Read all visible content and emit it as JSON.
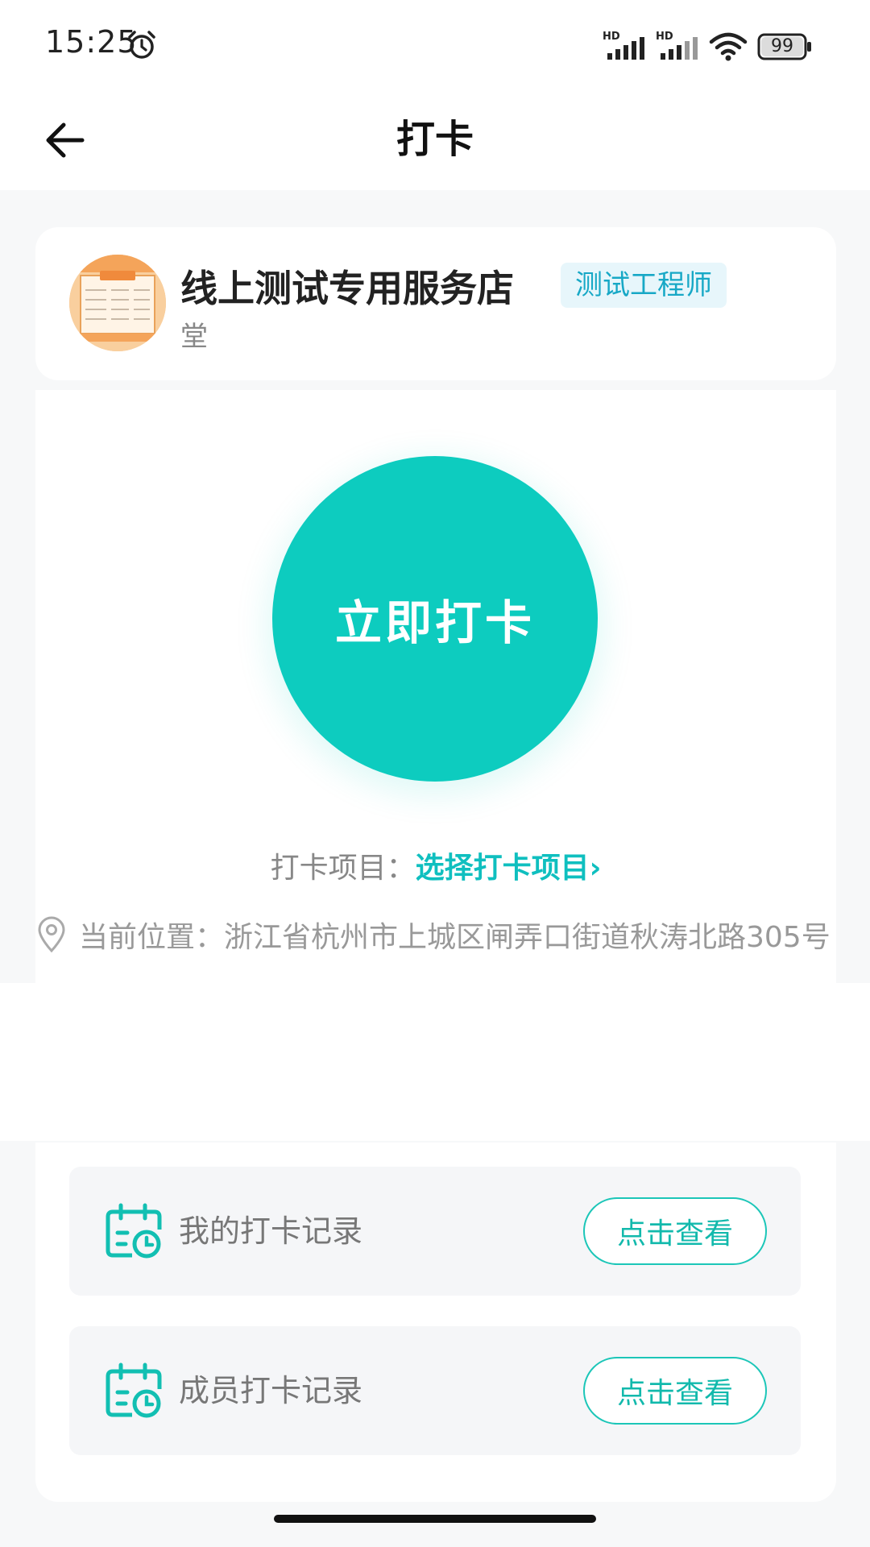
{
  "status_bar": {
    "time": "15:25",
    "signal_label_1": "HD",
    "signal_label_2": "HD",
    "battery": "99"
  },
  "nav": {
    "title": "打卡"
  },
  "store": {
    "name": "线上测试专用服务店",
    "name_continued": "堂",
    "role_badge": "测试工程师"
  },
  "punch": {
    "button_label": "立即打卡",
    "item_label": "打卡项目：",
    "item_select": "选择打卡项目›",
    "location_text": "当前位置：浙江省杭州市上城区闸弄口街道秋涛北路305号"
  },
  "records": [
    {
      "label": "我的打卡记录",
      "action": "点击查看"
    },
    {
      "label": "成员打卡记录",
      "action": "点击查看"
    }
  ],
  "colors": {
    "accent": "#0dccbf",
    "badge_text": "#17a8c6",
    "badge_bg": "#e7f6fb",
    "page_bg": "#f7f8f9"
  },
  "icons": {
    "alarm": "alarm-clock-icon",
    "back": "arrow-left-icon",
    "location": "location-pin-icon",
    "record": "calendar-clock-icon",
    "wifi": "wifi-icon",
    "battery": "battery-icon"
  }
}
